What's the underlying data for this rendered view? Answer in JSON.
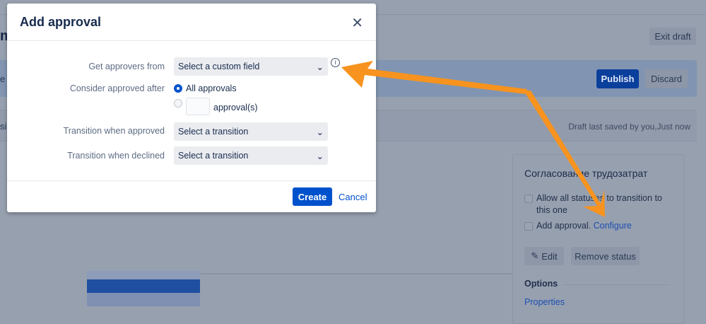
{
  "background": {
    "partial_heading": "m",
    "partial_banner": "e a",
    "partial_tab": "si",
    "exit_draft": "Exit draft",
    "publish": "Publish",
    "discard": "Discard",
    "draft_info": "Draft last saved by you,Just now",
    "status_card": {
      "title": "Согласование трудозатрат",
      "allow_all": "Allow all statuses to transition to this one",
      "add_approval": "Add approval.",
      "configure": "Configure",
      "edit": "Edit",
      "remove_status": "Remove status",
      "options": "Options",
      "properties": "Properties"
    }
  },
  "dialog": {
    "title": "Add approval",
    "fields": {
      "approvers_label": "Get approvers from",
      "approvers_value": "Select a custom field",
      "consider_label": "Consider approved after",
      "all_approvals": "All approvals",
      "approvals_count_value": "",
      "approvals_suffix": "approval(s)",
      "approved_label": "Transition when approved",
      "approved_value": "Select a transition",
      "declined_label": "Transition when declined",
      "declined_value": "Select a transition"
    },
    "create": "Create",
    "cancel": "Cancel"
  },
  "colors": {
    "accent": "#0052cc",
    "annotation": "#f7931e"
  }
}
